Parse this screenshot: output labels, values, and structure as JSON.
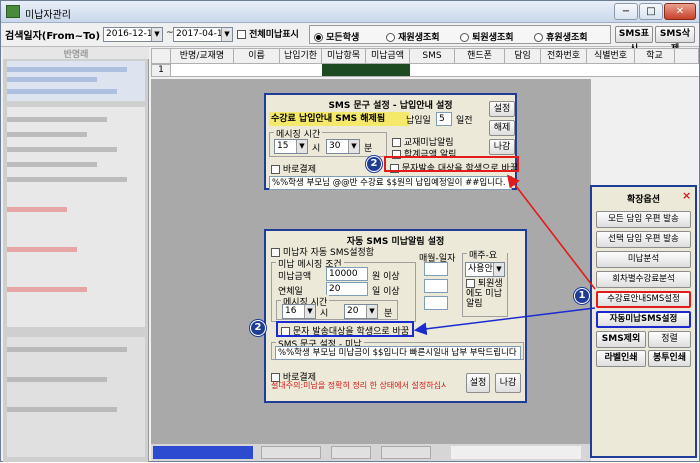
{
  "window": {
    "title": "미납자관리",
    "minimize": "−",
    "maximize": "□",
    "close": "✕"
  },
  "toolbar": {
    "search_label": "검색일자(From~To)",
    "date_from": "2016-12-17",
    "date_to": "2017-04-17",
    "date_sep": "~",
    "show_all_label": "전체미납표시",
    "radios": [
      "모든학생",
      "재원생조회",
      "퇴원생조회",
      "휴원생조회"
    ],
    "sms_show": "SMS표시",
    "sms_delete": "SMS삭제"
  },
  "sidebar": {
    "header": "반명래"
  },
  "grid": {
    "headers": [
      "반명/교재명",
      "이름",
      "납입기한",
      "미납항목",
      "미납금액",
      "SMS",
      "핸드폰",
      "담임",
      "전화번호",
      "식별번호",
      "학교"
    ],
    "row_number": "1"
  },
  "dialog1": {
    "title": "SMS 문구 설정 - 납입안내 설정",
    "banner": "수강료 납입안내 SMS 해제됨",
    "due_prefix": "납입일",
    "due_value": "5",
    "due_suffix": "일전",
    "msg_time_label": "메시징 시간",
    "hour": "15",
    "hour_unit": "시",
    "minute": "30",
    "minute_unit": "분",
    "check_material": "교재미납알림",
    "check_total": "합계금액 알림",
    "check_direct": "바로결제",
    "check_recipient": "문자발송 대상을 학생으로 바꿈",
    "message": "%%학생 부모님 @@반 수강료 $$원의 납입예정일이 ##입니다.",
    "btn_set": "설정",
    "btn_release": "해제",
    "btn_exit": "나감"
  },
  "dialog2": {
    "title": "자동 SMS 미납알림 설정",
    "check_auto": "미납자 자동 SMS설정함",
    "cond_legend": "미납 메시징 조건",
    "amount_label": "미납금액",
    "amount_value": "10000",
    "amount_suffix": "원 이상",
    "days_label": "연체일",
    "days_value": "20",
    "days_suffix": "일 이상",
    "time_label": "메시징 시간",
    "hour": "16",
    "hour_unit": "시",
    "minute": "20",
    "minute_unit": "분",
    "monthly_label": "매월-일자",
    "weekly_label": "매주-요일",
    "weekday_value": "사용안함",
    "check_retired": "퇴원생에도 미납알림",
    "check_recipient": "문자 발송대상을 학생으로 바꿈",
    "msg_legend": "SMS 문구 설정 - 미납",
    "message": "%%학생 부모님 미납금이 $$입니다 빠른시일내 납부 부탁드립니다",
    "check_direct": "바로결제",
    "warning": "절대주의:미납을 정확히 정리 한 상태에서 설정하십시요!!. 정리되지 않은 미납까지 모두 메시지 발송",
    "btn_set": "설정",
    "btn_exit": "나감"
  },
  "panel": {
    "title": "확장옵션",
    "close": "×",
    "buttons": [
      "모든 담임 우편 발송",
      "선택 담임 우편 발송",
      "미납분석",
      "회차별수강료분석",
      "수강료안내SMS설정",
      "자동미납SMS설정"
    ],
    "small_buttons": [
      "SMS제외",
      "정렬",
      "라벨인쇄",
      "봉투인쇄"
    ]
  },
  "callouts": {
    "one": "1",
    "two": "2"
  },
  "colors": {
    "accent_blue": "#1f3d95",
    "callout_red": "#e21b1b",
    "callout_blue": "#1a2bd0"
  }
}
